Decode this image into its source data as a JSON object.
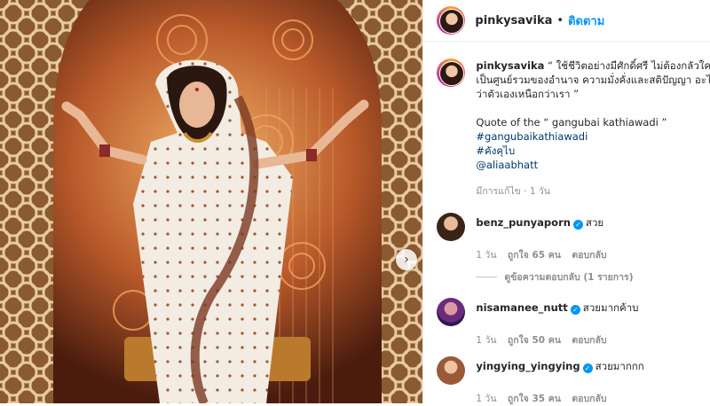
{
  "post": {
    "username": "pinkysavika",
    "separator": "•",
    "follow_label": "ติดตาม",
    "next_icon": "chevron-right-icon"
  },
  "caption": {
    "username": "pinkysavika",
    "line1": "“ ใช้ชีวิตอย่างมีศักดิ์ศรี ไม่ต้องกลัวใครทั้",
    "line2": "เป็นศูนย์รวมของอำนาจ ความมั่งคั่งและสติปัญญา อะไร",
    "line3": "ว่าตัวเองเหนือกว่าเรา ”",
    "quote": "Quote of the “ gangubai kathiawadi ”",
    "hashtags": [
      "#gangubaikathiawadi",
      "#คังคุไบ"
    ],
    "mention": "@aliaabhatt",
    "meta": "มีการแก้ไข · 1 วัน"
  },
  "comments": [
    {
      "username": "benz_punyaporn",
      "verified": true,
      "text": "สวย",
      "time": "1 วัน",
      "likes": "ถูกใจ 65 คน",
      "reply": "ตอบกลับ"
    },
    {
      "username": "nisamanee_nutt",
      "verified": true,
      "text": "สวยมากค้าบ",
      "time": "1 วัน",
      "likes": "ถูกใจ 50 คน",
      "reply": "ตอบกลับ"
    },
    {
      "username": "yingying_yingying",
      "verified": true,
      "text": "สวยมากกก",
      "time": "1 วัน",
      "likes": "ถูกใจ 35 คน",
      "reply": "ตอบกลับ"
    }
  ],
  "view_replies": "ดูข้อความตอบกลับ (1 รายการ)",
  "verified_icon": "✓"
}
